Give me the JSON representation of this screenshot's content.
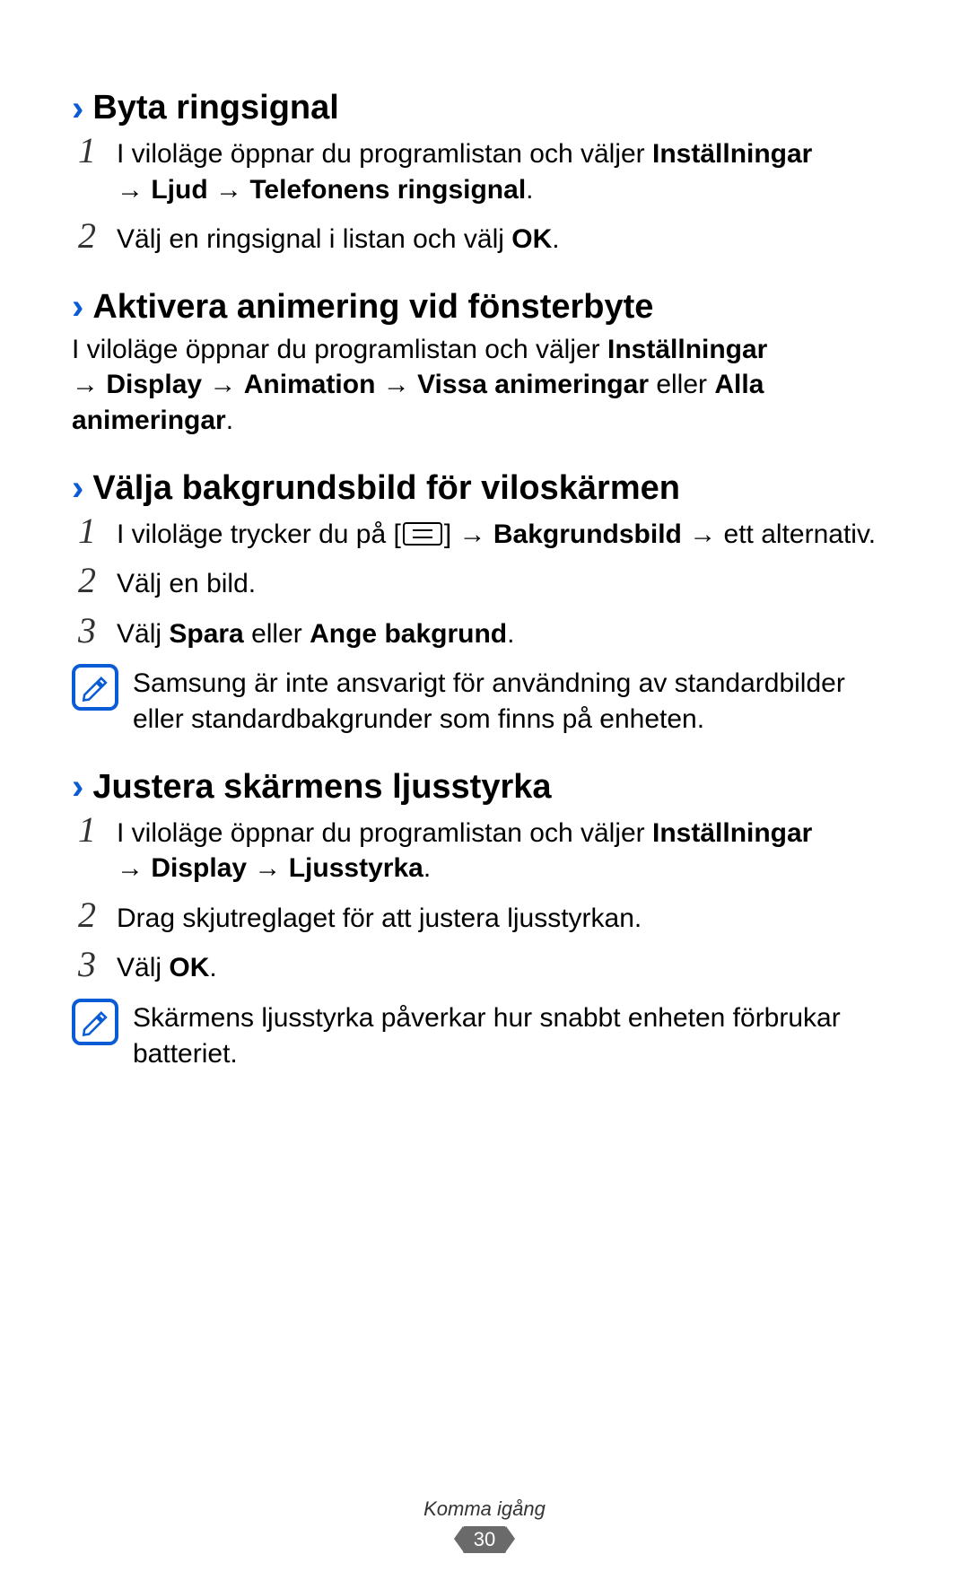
{
  "sections": {
    "s1": {
      "title": "Byta ringsignal",
      "steps": [
        {
          "num": "1",
          "pre": "I viloläge öppnar du programlistan och väljer ",
          "b1": "Inställningar",
          "mid1": " → ",
          "b2": "Ljud",
          "mid2": " → ",
          "b3": "Telefonens ringsignal",
          "post": "."
        },
        {
          "num": "2",
          "pre": "Välj en ringsignal i listan och välj ",
          "b1": "OK",
          "post": "."
        }
      ]
    },
    "s2": {
      "title": "Aktivera animering vid fönsterbyte",
      "para": {
        "pre": "I viloläge öppnar du programlistan och väljer ",
        "b1": "Inställningar",
        "mid1": " → ",
        "b2": "Display",
        "mid2": " → ",
        "b3": "Animation",
        "mid3": " → ",
        "b4": "Vissa animeringar",
        "mid4": " eller ",
        "b5": "Alla animeringar",
        "post": "."
      }
    },
    "s3": {
      "title": "Välja bakgrundsbild för viloskärmen",
      "steps": [
        {
          "num": "1",
          "pre": "I viloläge trycker du på [",
          "postIcon": "] → ",
          "b1": "Bakgrundsbild",
          "mid1": " → ett alternativ."
        },
        {
          "num": "2",
          "pre": "Välj en bild."
        },
        {
          "num": "3",
          "pre": "Välj ",
          "b1": "Spara",
          "mid1": " eller ",
          "b2": "Ange bakgrund",
          "post": "."
        }
      ],
      "note": "Samsung är inte ansvarigt för användning av standardbilder eller standardbakgrunder som finns på enheten."
    },
    "s4": {
      "title": "Justera skärmens ljusstyrka",
      "steps": [
        {
          "num": "1",
          "pre": "I viloläge öppnar du programlistan och väljer ",
          "b1": "Inställningar",
          "mid1": " → ",
          "b2": "Display",
          "mid2": " → ",
          "b3": "Ljusstyrka",
          "post": "."
        },
        {
          "num": "2",
          "pre": "Drag skjutreglaget för att justera ljusstyrkan."
        },
        {
          "num": "3",
          "pre": "Välj ",
          "b1": "OK",
          "post": "."
        }
      ],
      "note": "Skärmens ljusstyrka påverkar hur snabbt enheten förbrukar batteriet."
    }
  },
  "footer": {
    "label": "Komma igång",
    "page": "30"
  }
}
